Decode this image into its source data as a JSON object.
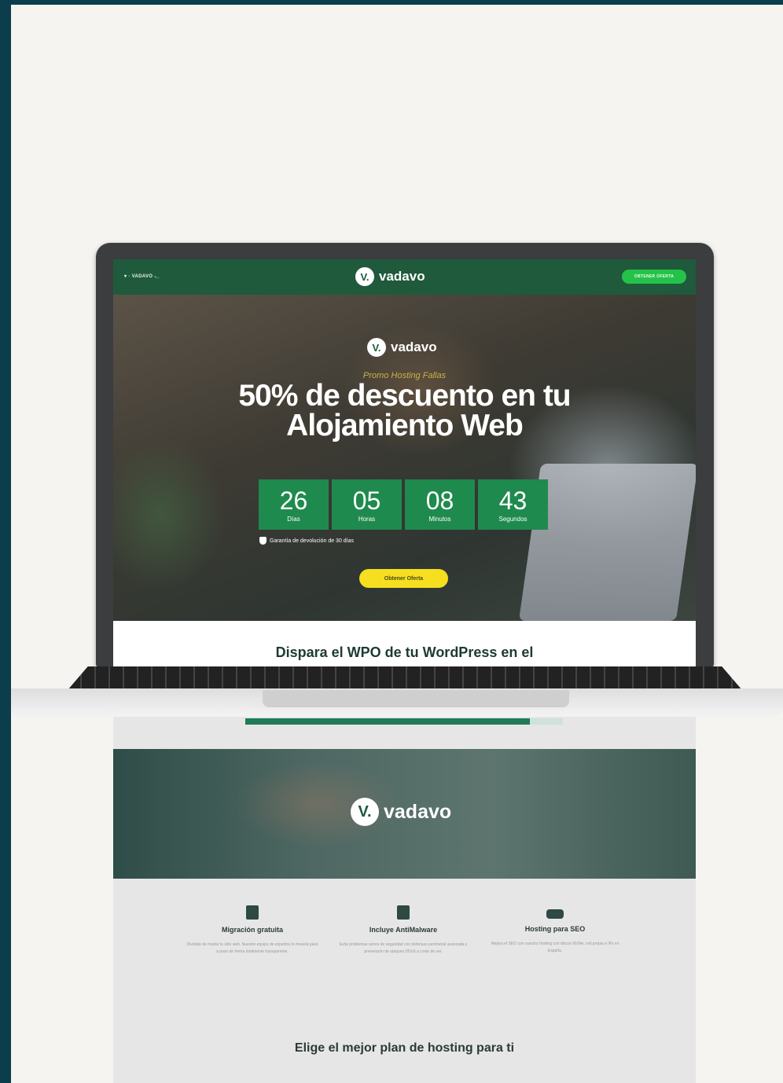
{
  "topbar": {
    "mini_brand": "▾ ◦ VADAVO  ⸜_",
    "logo_text": "vadavo",
    "logo_mark": "V.",
    "offer_button": "OBTENER OFERTA"
  },
  "hero": {
    "logo_text": "vadavo",
    "logo_mark": "V.",
    "promo": "Promo Hosting Fallas",
    "headline": "50% de descuento en tu Alojamiento Web",
    "countdown": [
      {
        "value": "26",
        "label": "Días"
      },
      {
        "value": "05",
        "label": "Horas"
      },
      {
        "value": "08",
        "label": "Minutos"
      },
      {
        "value": "43",
        "label": "Segundos"
      }
    ],
    "guarantee": "Garantía de devolución de 30 días",
    "cta": "Obtener Oferta"
  },
  "section_title": "Dispara el WPO de tu WordPress en el",
  "progress": 0.895,
  "band": {
    "logo_text": "vadavo",
    "logo_mark": "V."
  },
  "features": [
    {
      "icon": "file-migration-icon",
      "title": "Migración gratuita",
      "desc": "Olvídate de mudar tu sitio web. Nuestro equipo de expertos lo moverá paso a paso de forma totalmente transparente."
    },
    {
      "icon": "malware-shield-icon",
      "title": "Incluye AntiMalware",
      "desc": "Evita problemas serios de seguridad con defensas perimetral avanzada y prevención de ataques DDoS a coste de ser."
    },
    {
      "icon": "hard-drive-icon",
      "title": "Hosting para SEO",
      "desc": "Mejora el SEO con nuestro hosting con discos NVMe, red propia e IPs en España."
    }
  ],
  "plans_title": "Elige el mejor plan de hosting para ti",
  "colors": {
    "brand_green": "#1f5a3c",
    "counter_green": "#1f8a4d",
    "cta_yellow": "#f5df1f",
    "frame": "#0b3d4c"
  }
}
